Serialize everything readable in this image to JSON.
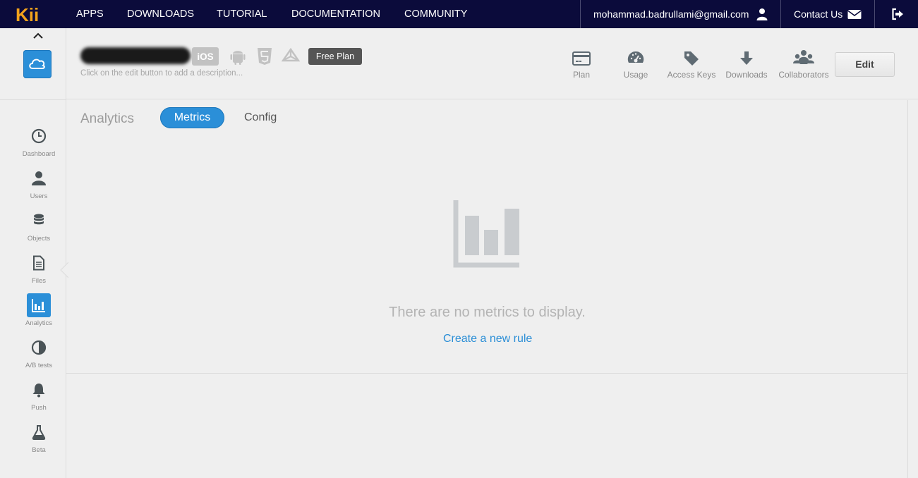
{
  "topnav": {
    "logo_text": "Kii",
    "items": [
      "APPS",
      "DOWNLOADS",
      "TUTORIAL",
      "DOCUMENTATION",
      "COMMUNITY"
    ],
    "user_email": "mohammad.badrullami@gmail.com",
    "contact_label": "Contact Us"
  },
  "app": {
    "description": "Click on the edit button to add a description...",
    "platforms": [
      "iOS",
      "android-icon",
      "html5-icon",
      "unity-icon"
    ],
    "ios_label": "iOS",
    "plan_badge": "Free Plan",
    "edit_label": "Edit",
    "header_buttons": [
      {
        "label": "Plan",
        "icon": "credit-card-icon"
      },
      {
        "label": "Usage",
        "icon": "dashboard-gauge-icon"
      },
      {
        "label": "Access Keys",
        "icon": "tag-icon"
      },
      {
        "label": "Downloads",
        "icon": "download-arrow-icon"
      },
      {
        "label": "Collaborators",
        "icon": "users-group-icon"
      }
    ]
  },
  "sidebar": {
    "items": [
      {
        "label": "Dashboard",
        "icon": "clock-icon"
      },
      {
        "label": "Users",
        "icon": "user-icon"
      },
      {
        "label": "Objects",
        "icon": "database-icon"
      },
      {
        "label": "Files",
        "icon": "file-icon"
      },
      {
        "label": "Analytics",
        "icon": "bar-chart-icon",
        "active": true
      },
      {
        "label": "A/B tests",
        "icon": "half-circle-icon"
      },
      {
        "label": "Push",
        "icon": "bell-icon"
      },
      {
        "label": "Beta",
        "icon": "flask-icon"
      }
    ]
  },
  "main": {
    "section_title": "Analytics",
    "tabs": [
      {
        "label": "Metrics",
        "active": true
      },
      {
        "label": "Config",
        "active": false
      }
    ],
    "empty_message": "There are no metrics to display.",
    "create_link": "Create a new rule"
  },
  "colors": {
    "nav_bg": "#0b0b3b",
    "accent": "#2b8fd8",
    "logo": "#f2a21c",
    "icon_gray": "#5f6b73"
  }
}
